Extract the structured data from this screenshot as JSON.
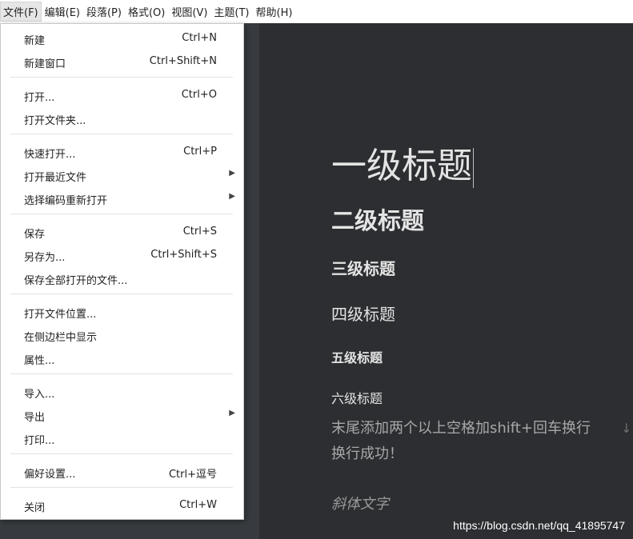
{
  "menubar": {
    "items": [
      {
        "label": "文件(F)"
      },
      {
        "label": "编辑(E)"
      },
      {
        "label": "段落(P)"
      },
      {
        "label": "格式(O)"
      },
      {
        "label": "视图(V)"
      },
      {
        "label": "主题(T)"
      },
      {
        "label": "帮助(H)"
      }
    ]
  },
  "file_menu": {
    "items": [
      {
        "label": "新建",
        "shortcut": "Ctrl+N"
      },
      {
        "label": "新建窗口",
        "shortcut": "Ctrl+Shift+N"
      },
      {
        "label": "打开...",
        "shortcut": "Ctrl+O"
      },
      {
        "label": "打开文件夹...",
        "shortcut": ""
      },
      {
        "label": "快速打开...",
        "shortcut": "Ctrl+P"
      },
      {
        "label": "打开最近文件",
        "shortcut": ""
      },
      {
        "label": "选择编码重新打开",
        "shortcut": ""
      },
      {
        "label": "保存",
        "shortcut": "Ctrl+S"
      },
      {
        "label": "另存为...",
        "shortcut": "Ctrl+Shift+S"
      },
      {
        "label": "保存全部打开的文件...",
        "shortcut": ""
      },
      {
        "label": "打开文件位置...",
        "shortcut": ""
      },
      {
        "label": "在侧边栏中显示",
        "shortcut": ""
      },
      {
        "label": "属性...",
        "shortcut": ""
      },
      {
        "label": "导入...",
        "shortcut": ""
      },
      {
        "label": "导出",
        "shortcut": ""
      },
      {
        "label": "打印...",
        "shortcut": ""
      },
      {
        "label": "偏好设置...",
        "shortcut": "Ctrl+逗号"
      },
      {
        "label": "关闭",
        "shortcut": "Ctrl+W"
      }
    ],
    "submenu_arrow": "▶"
  },
  "document": {
    "h1": "一级标题",
    "h2": "二级标题",
    "h3": "三级标题",
    "h4": "四级标题",
    "h5": "五级标题",
    "h6": "六级标题",
    "paragraph": "末尾添加两个以上空格加shift+回车换行",
    "paragraph2": "换行成功！",
    "italic": "斜体文字"
  },
  "watermark": "https://blog.csdn.net/qq_41895747",
  "colors": {
    "editor_bg": "#2c2e31",
    "sidebar_bg": "#373a3e",
    "menu_bg": "#ffffff"
  }
}
